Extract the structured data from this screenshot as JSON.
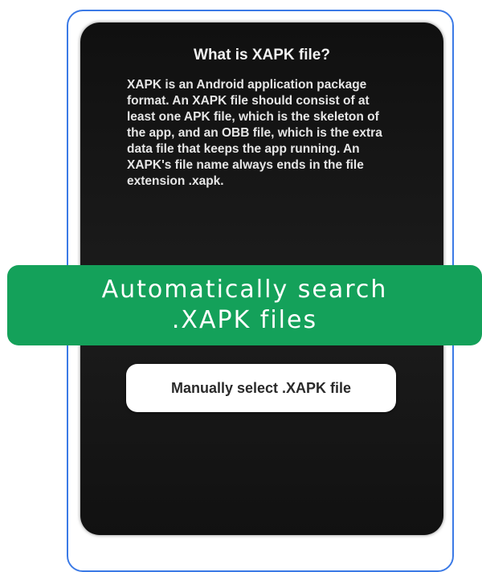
{
  "info": {
    "title": "What is XAPK file?",
    "body": "XAPK is an Android application package format. An XAPK file should consist of at least one APK file, which is the skeleton of the app, and an OBB file, which is the extra data file that keeps the app running. An XAPK's file name always ends in the file extension .xapk."
  },
  "actions": {
    "auto_search_label": "Automatically search .XAPK files",
    "manual_select_label": "Manually select .XAPK file"
  },
  "colors": {
    "accent_green": "#14a15a",
    "frame_blue": "#3b7ae6"
  }
}
